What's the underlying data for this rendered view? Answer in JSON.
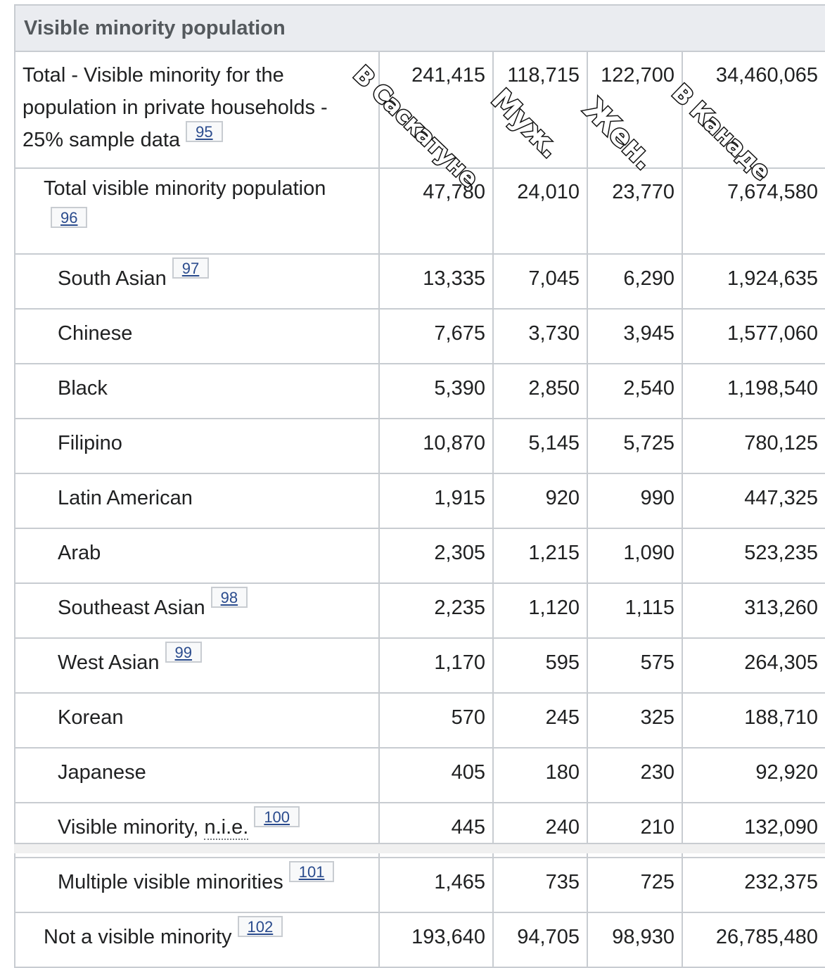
{
  "section_title": "Visible minority population",
  "annotations": {
    "col1": "В Саскатуне",
    "col2": "Муж.",
    "col3": "Жен.",
    "col4": "В Канаде"
  },
  "rows": [
    {
      "label": "Total - Visible minority for the population in private households - 25% sample data",
      "ref": "95",
      "v1": "241,415",
      "v2": "118,715",
      "v3": "122,700",
      "v4": "34,460,065"
    },
    {
      "label": "Total visible minority population",
      "ref": "96",
      "v1": "47,780",
      "v2": "24,010",
      "v3": "23,770",
      "v4": "7,674,580"
    },
    {
      "label": "South Asian",
      "ref": "97",
      "v1": "13,335",
      "v2": "7,045",
      "v3": "6,290",
      "v4": "1,924,635"
    },
    {
      "label": "Chinese",
      "ref": "",
      "v1": "7,675",
      "v2": "3,730",
      "v3": "3,945",
      "v4": "1,577,060"
    },
    {
      "label": "Black",
      "ref": "",
      "v1": "5,390",
      "v2": "2,850",
      "v3": "2,540",
      "v4": "1,198,540"
    },
    {
      "label": "Filipino",
      "ref": "",
      "v1": "10,870",
      "v2": "5,145",
      "v3": "5,725",
      "v4": "780,125"
    },
    {
      "label": "Latin American",
      "ref": "",
      "v1": "1,915",
      "v2": "920",
      "v3": "990",
      "v4": "447,325"
    },
    {
      "label": "Arab",
      "ref": "",
      "v1": "2,305",
      "v2": "1,215",
      "v3": "1,090",
      "v4": "523,235"
    },
    {
      "label": "Southeast Asian",
      "ref": "98",
      "v1": "2,235",
      "v2": "1,120",
      "v3": "1,115",
      "v4": "313,260"
    },
    {
      "label": "West Asian",
      "ref": "99",
      "v1": "1,170",
      "v2": "595",
      "v3": "575",
      "v4": "264,305"
    },
    {
      "label": "Korean",
      "ref": "",
      "v1": "570",
      "v2": "245",
      "v3": "325",
      "v4": "188,710"
    },
    {
      "label": "Japanese",
      "ref": "",
      "v1": "405",
      "v2": "180",
      "v3": "230",
      "v4": "92,920"
    },
    {
      "label_prefix": "Visible minority, ",
      "label_abbr": "n.i.e.",
      "ref": "100",
      "v1": "445",
      "v2": "240",
      "v3": "210",
      "v4": "132,090"
    },
    {
      "label": "Multiple visible minorities",
      "ref": "101",
      "v1": "1,465",
      "v2": "735",
      "v3": "725",
      "v4": "232,375"
    },
    {
      "label": "Not a visible minority",
      "ref": "102",
      "v1": "193,640",
      "v2": "94,705",
      "v3": "98,930",
      "v4": "26,785,480"
    }
  ]
}
